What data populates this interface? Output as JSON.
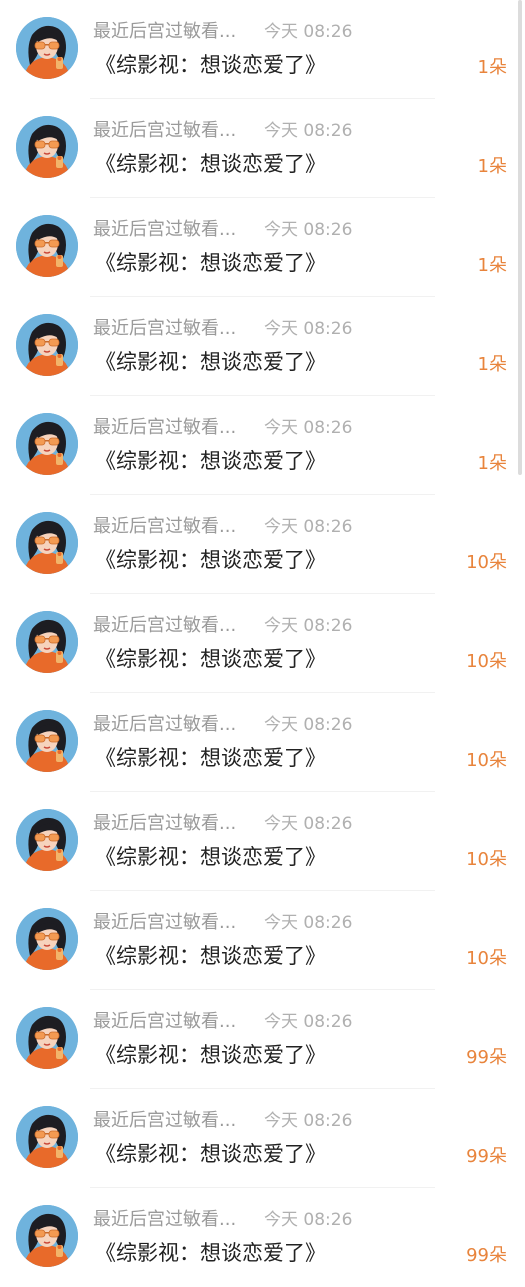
{
  "items": [
    {
      "user": "最近后宫过敏看...",
      "time": "今天 08:26",
      "book": "《综影视：想谈恋爱了》",
      "amount": "1朵"
    },
    {
      "user": "最近后宫过敏看...",
      "time": "今天 08:26",
      "book": "《综影视：想谈恋爱了》",
      "amount": "1朵"
    },
    {
      "user": "最近后宫过敏看...",
      "time": "今天 08:26",
      "book": "《综影视：想谈恋爱了》",
      "amount": "1朵"
    },
    {
      "user": "最近后宫过敏看...",
      "time": "今天 08:26",
      "book": "《综影视：想谈恋爱了》",
      "amount": "1朵"
    },
    {
      "user": "最近后宫过敏看...",
      "time": "今天 08:26",
      "book": "《综影视：想谈恋爱了》",
      "amount": "1朵"
    },
    {
      "user": "最近后宫过敏看...",
      "time": "今天 08:26",
      "book": "《综影视：想谈恋爱了》",
      "amount": "10朵"
    },
    {
      "user": "最近后宫过敏看...",
      "time": "今天 08:26",
      "book": "《综影视：想谈恋爱了》",
      "amount": "10朵"
    },
    {
      "user": "最近后宫过敏看...",
      "time": "今天 08:26",
      "book": "《综影视：想谈恋爱了》",
      "amount": "10朵"
    },
    {
      "user": "最近后宫过敏看...",
      "time": "今天 08:26",
      "book": "《综影视：想谈恋爱了》",
      "amount": "10朵"
    },
    {
      "user": "最近后宫过敏看...",
      "time": "今天 08:26",
      "book": "《综影视：想谈恋爱了》",
      "amount": "10朵"
    },
    {
      "user": "最近后宫过敏看...",
      "time": "今天 08:26",
      "book": "《综影视：想谈恋爱了》",
      "amount": "99朵"
    },
    {
      "user": "最近后宫过敏看...",
      "time": "今天 08:26",
      "book": "《综影视：想谈恋爱了》",
      "amount": "99朵"
    },
    {
      "user": "最近后宫过敏看...",
      "time": "今天 08:26",
      "book": "《综影视：想谈恋爱了》",
      "amount": "99朵"
    }
  ],
  "avatar_icon": "user-avatar-icon",
  "colors": {
    "amount": "#e8843c",
    "username": "#9a9a9a",
    "time": "#b0b0b0",
    "title": "#222222",
    "avatar_bg": "#6fb3dd"
  }
}
